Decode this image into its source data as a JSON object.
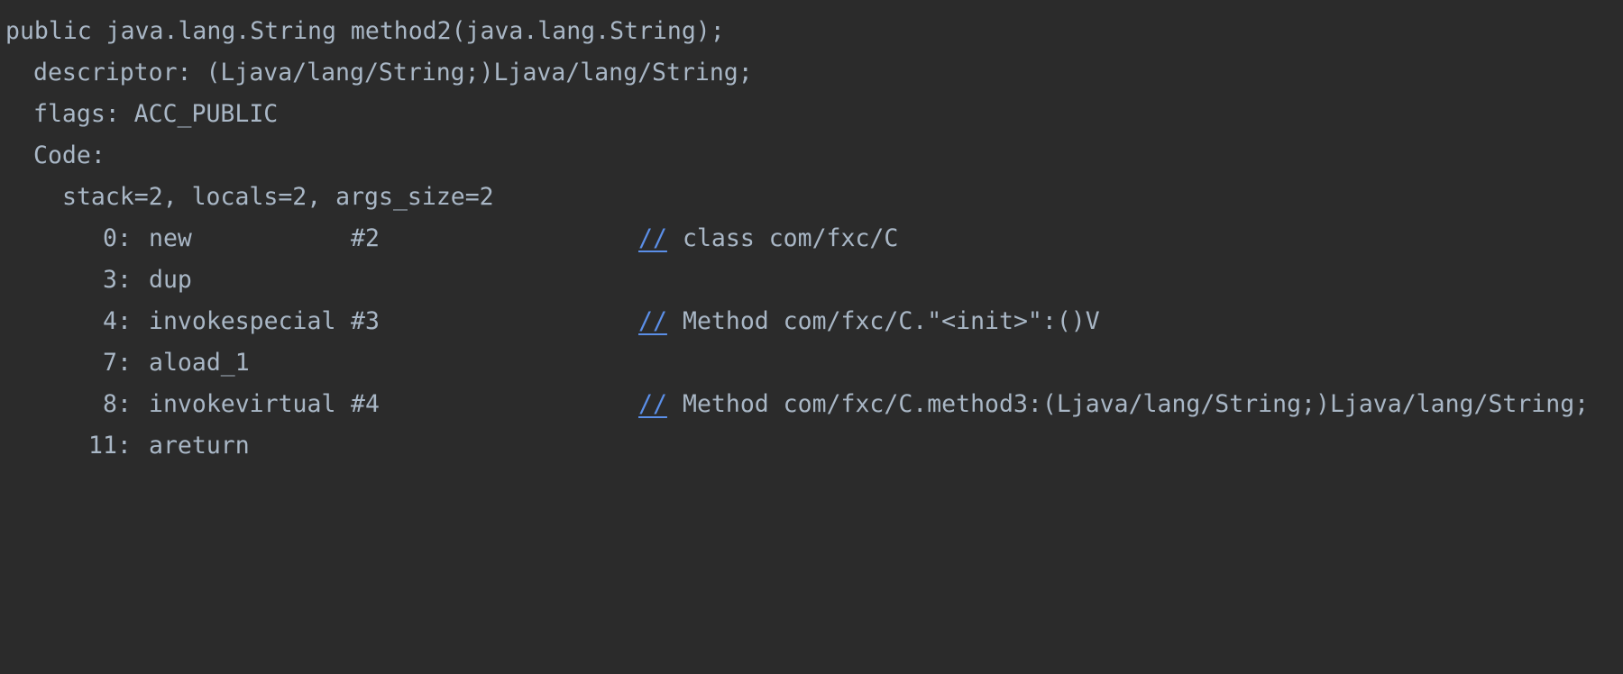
{
  "code": {
    "method_signature": "public java.lang.String method2(java.lang.String);",
    "descriptor": "descriptor: (Ljava/lang/String;)Ljava/lang/String;",
    "flags": "flags: ACC_PUBLIC",
    "code_label": "Code:",
    "stack_info": "stack=2, locals=2, args_size=2",
    "comment_marker": "//",
    "instructions": [
      {
        "offset": "0:",
        "opcode": "new",
        "operand": "#2",
        "comment": "class com/fxc/C"
      },
      {
        "offset": "3:",
        "opcode": "dup",
        "operand": "",
        "comment": ""
      },
      {
        "offset": "4:",
        "opcode": "invokespecial",
        "operand": "#3",
        "comment": "Method com/fxc/C.\"<init>\":()V"
      },
      {
        "offset": "7:",
        "opcode": "aload_1",
        "operand": "",
        "comment": ""
      },
      {
        "offset": "8:",
        "opcode": "invokevirtual",
        "operand": "#4",
        "comment": "Method com/fxc/C.method3:(Ljava/lang/String;)Ljava/lang/String;"
      },
      {
        "offset": "11:",
        "opcode": "areturn",
        "operand": "",
        "comment": ""
      }
    ]
  },
  "colors": {
    "background": "#2b2b2b",
    "text": "#a9b7c6",
    "comment_marker": "#5b8fe8"
  }
}
